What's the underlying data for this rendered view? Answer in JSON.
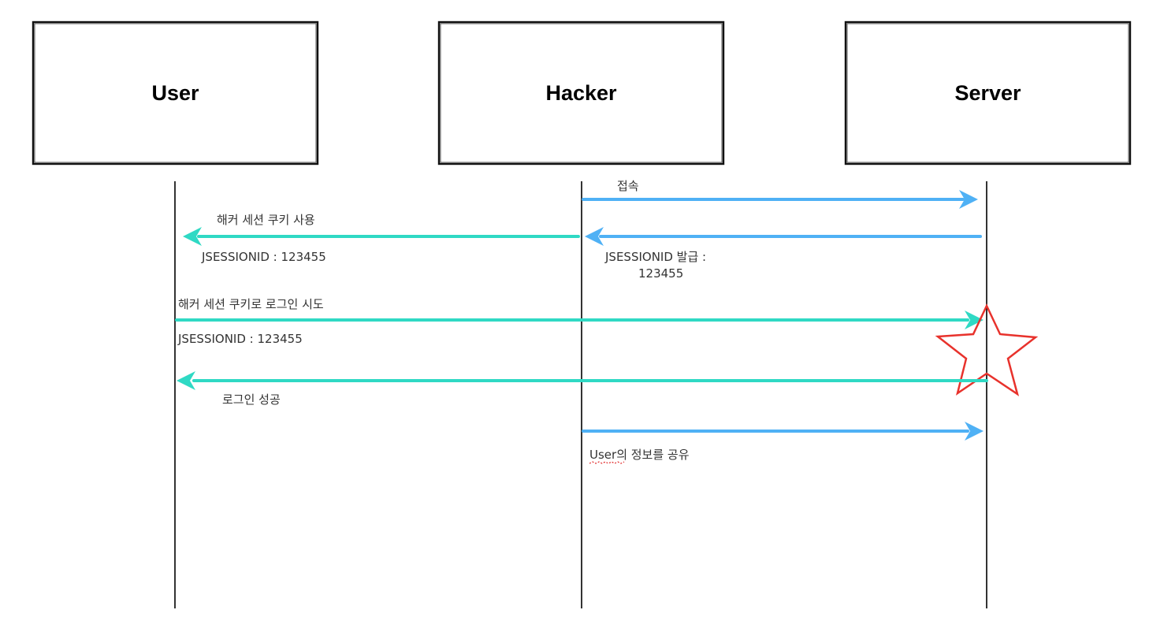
{
  "actors": [
    {
      "id": "user",
      "label": "User"
    },
    {
      "id": "hacker",
      "label": "Hacker"
    },
    {
      "id": "server",
      "label": "Server"
    }
  ],
  "messages": [
    {
      "id": "connect",
      "from": "hacker",
      "to": "server",
      "color": "#4fb1f5",
      "labels": [
        "접속"
      ]
    },
    {
      "id": "issue-session",
      "from": "server",
      "to": "hacker",
      "color": "#4fb1f5",
      "labels": [
        "JSESSIONID 발급 :",
        "123455"
      ]
    },
    {
      "id": "use-hacker-cookie",
      "from": "hacker",
      "to": "user",
      "color": "#2fd9c4",
      "labels": [
        "해커 세션 쿠키 사용",
        "JSESSIONID : 123455"
      ]
    },
    {
      "id": "login-attempt",
      "from": "user",
      "to": "server",
      "color": "#2fd9c4",
      "labels": [
        "해커 세션 쿠키로 로그인 시도",
        "JSESSIONID : 123455"
      ]
    },
    {
      "id": "login-success",
      "from": "server",
      "to": "user",
      "color": "#2fd9c4",
      "labels": [
        "로그인 성공"
      ]
    },
    {
      "id": "share-user-info",
      "from": "hacker",
      "to": "server",
      "color": "#4fb1f5",
      "labels": [
        "User의 정보를 공유"
      ]
    }
  ],
  "highlight": {
    "shape": "star",
    "color": "#e8322c",
    "near": "server"
  },
  "colors": {
    "blue_arrow": "#4fb1f5",
    "teal_arrow": "#2fd9c4",
    "lifeline": "#000000",
    "star": "#e8322c",
    "text": "#333333"
  }
}
